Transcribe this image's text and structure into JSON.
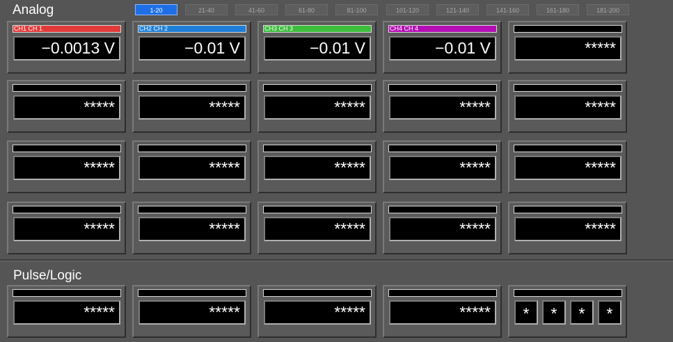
{
  "analog": {
    "title": "Analog",
    "range_tabs": [
      "1-20",
      "21-40",
      "41-60",
      "61-80",
      "81-100",
      "101-120",
      "121-140",
      "141-160",
      "161-180",
      "181-200"
    ],
    "active_tab": "1-20",
    "channels": [
      {
        "label": "CH1  CH 1",
        "value": "−0.0013 V",
        "color": "#e23a3a"
      },
      {
        "label": "CH2  CH 2",
        "value": "−0.01 V",
        "color": "#1e7fd8"
      },
      {
        "label": "CH3  CH 3",
        "value": "−0.01 V",
        "color": "#3cbd3c"
      },
      {
        "label": "CH4  CH 4",
        "value": "−0.01 V",
        "color": "#b40fb4"
      },
      {
        "label": "",
        "value": "*****",
        "color": "#000000"
      },
      {
        "label": "",
        "value": "*****",
        "color": "#000000"
      },
      {
        "label": "",
        "value": "*****",
        "color": "#000000"
      },
      {
        "label": "",
        "value": "*****",
        "color": "#000000"
      },
      {
        "label": "",
        "value": "*****",
        "color": "#000000"
      },
      {
        "label": "",
        "value": "*****",
        "color": "#000000"
      },
      {
        "label": "",
        "value": "*****",
        "color": "#000000"
      },
      {
        "label": "",
        "value": "*****",
        "color": "#000000"
      },
      {
        "label": "",
        "value": "*****",
        "color": "#000000"
      },
      {
        "label": "",
        "value": "*****",
        "color": "#000000"
      },
      {
        "label": "",
        "value": "*****",
        "color": "#000000"
      },
      {
        "label": "",
        "value": "*****",
        "color": "#000000"
      },
      {
        "label": "",
        "value": "*****",
        "color": "#000000"
      },
      {
        "label": "",
        "value": "*****",
        "color": "#000000"
      },
      {
        "label": "",
        "value": "*****",
        "color": "#000000"
      },
      {
        "label": "",
        "value": "*****",
        "color": "#000000"
      }
    ]
  },
  "pulse_logic": {
    "title": "Pulse/Logic",
    "pulse_channels": [
      {
        "label": "",
        "value": "*****"
      },
      {
        "label": "",
        "value": "*****"
      },
      {
        "label": "",
        "value": "*****"
      },
      {
        "label": "",
        "value": "*****"
      }
    ],
    "logic_channel": {
      "label": "",
      "bits": [
        "*",
        "*",
        "*",
        "*"
      ]
    }
  }
}
